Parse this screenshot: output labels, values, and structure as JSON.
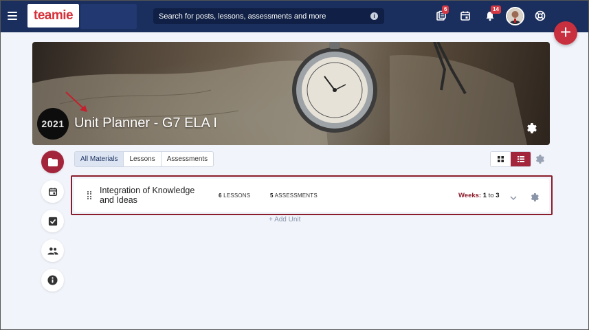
{
  "header": {
    "logo_text": "teamie",
    "search_placeholder": "Search for posts, lessons, assessments and more",
    "notifications": {
      "posts_badge": "6",
      "alerts_badge": "14"
    }
  },
  "fab_label": "+",
  "banner": {
    "title": "Unit Planner - G7 ELA I",
    "year_label": "2021"
  },
  "tabs": [
    {
      "label": "All Materials",
      "active": true
    },
    {
      "label": "Lessons",
      "active": false
    },
    {
      "label": "Assessments",
      "active": false
    }
  ],
  "unit": {
    "title": "Integration of Knowledge and Ideas",
    "lessons_count": "6",
    "lessons_label": "LESSONS",
    "assessments_count": "5",
    "assessments_label": "ASSESSMENTS",
    "weeks_label": "Weeks:",
    "weeks_from": "1",
    "weeks_to_word": "to",
    "weeks_to": "3"
  },
  "add_unit_label": "+ Add Unit",
  "colors": {
    "topbar": "#1b2f5e",
    "accent": "#a3253c",
    "badge": "#d43a46",
    "fab": "#c8303f"
  }
}
